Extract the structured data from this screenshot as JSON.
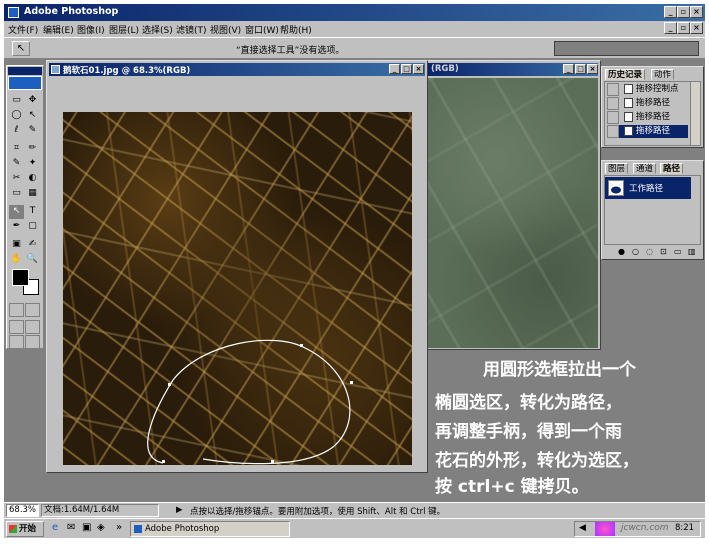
{
  "app": {
    "title": "Adobe Photoshop"
  },
  "menu": [
    "文件(F)",
    "编辑(E)",
    "图像(I)",
    "图层(L)",
    "选择(S)",
    "滤镜(T)",
    "视图(V)",
    "窗口(W)",
    "帮助(H)"
  ],
  "options_bar": {
    "message": "“直接选择工具”没有选项。"
  },
  "toolbox": {
    "tools": [
      "▭",
      "✥",
      "◯",
      "↖",
      "ℓ",
      "✎",
      "⌗",
      "✏",
      "✎",
      "✦",
      "✂",
      "◐",
      "▭",
      "▦",
      "◉",
      "◍",
      "↖",
      "T",
      "✒",
      "▢",
      "▣",
      "✍",
      "✋",
      "🔍"
    ]
  },
  "doc_main": {
    "title": "鹅软石01.jpg @ 68.3%(RGB)"
  },
  "doc_second": {
    "title": "(RGB)"
  },
  "history_palette": {
    "tabs": [
      "历史记录",
      "动作"
    ],
    "items": [
      "拖移控制点",
      "拖移路径",
      "拖移路径",
      "拖移路径"
    ]
  },
  "paths_palette": {
    "tabs": [
      "图层",
      "通道",
      "路径"
    ],
    "items": [
      "工作路径"
    ]
  },
  "caption": {
    "lines": [
      "用圆形选框拉出一个",
      "椭圆选区，转化为路径，",
      "再调整手柄，得到一个雨",
      "花石的外形，转化为选区，",
      "按 ctrl+c 键拷贝。"
    ]
  },
  "status": {
    "zoom": "68.3%",
    "doc_size": "文档:1.64M/1.64M",
    "hint": "点按以选择/拖移锚点。要用附加选项，使用 Shift、Alt 和 Ctrl 键。"
  },
  "taskbar": {
    "start": "开始",
    "task": "Adobe Photoshop",
    "clock": "8:21",
    "watermark": "jcwcn.com"
  },
  "colors": {
    "titlebar": "#0a246a",
    "face": "#c0c0c0",
    "workspace": "#808080"
  }
}
